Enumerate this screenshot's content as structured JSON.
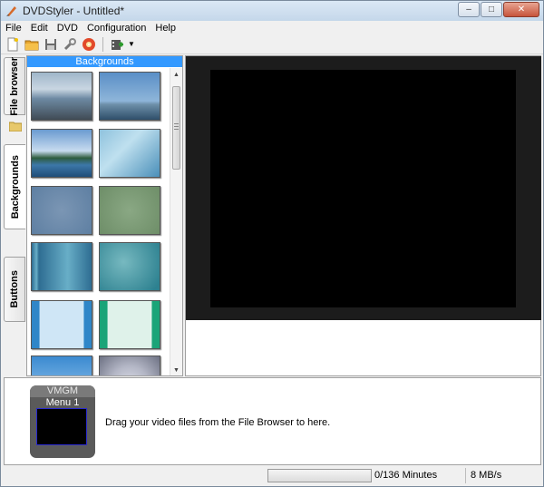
{
  "window": {
    "title": "DVDStyler - Untitled*",
    "buttons": {
      "minimize": "–",
      "maximize": "□",
      "close": "✕"
    }
  },
  "menu": [
    "File",
    "Edit",
    "DVD",
    "Configuration",
    "Help"
  ],
  "toolbar": {
    "icons": [
      "new-project-icon",
      "open-folder-icon",
      "save-icon",
      "settings-icon",
      "burn-dvd-icon",
      "add-file-icon"
    ],
    "dropdown_arrow": "▼"
  },
  "tabs": {
    "file_browser": "File browser",
    "backgrounds": "Backgrounds",
    "buttons": "Buttons",
    "active": "Backgrounds"
  },
  "panel": {
    "header": "Backgrounds",
    "scroll_up": "▲",
    "scroll_down": "▼"
  },
  "thumbnails": [
    {
      "kind": "photo-coast-cloudy",
      "colors": [
        "#9fb6c9",
        "#6e8aa3",
        "#404b55"
      ]
    },
    {
      "kind": "photo-harbor-sky",
      "colors": [
        "#5a8fc7",
        "#8eb5d9",
        "#2f4f6a"
      ]
    },
    {
      "kind": "photo-lake-hills",
      "colors": [
        "#6a9bd0",
        "#c7dbef",
        "#2e5c3e"
      ]
    },
    {
      "kind": "blue-rays",
      "colors": [
        "#8fc2dd",
        "#4a8fb9"
      ]
    },
    {
      "kind": "blurred-blue",
      "colors": [
        "#5e7fa2",
        "#7b96b4"
      ]
    },
    {
      "kind": "blurred-green",
      "colors": [
        "#6e8e68",
        "#8aa884"
      ]
    },
    {
      "kind": "teal-stripes",
      "colors": [
        "#2e6d92",
        "#68aec7"
      ]
    },
    {
      "kind": "teal-texture",
      "colors": [
        "#2d8190",
        "#77b9c0"
      ]
    },
    {
      "kind": "light-blue-frame",
      "colors": [
        "#cfe6f6",
        "#2f86c8"
      ]
    },
    {
      "kind": "mint-frame",
      "colors": [
        "#dff2ea",
        "#1aa478"
      ]
    },
    {
      "kind": "sky-frame",
      "colors": [
        "#3b8ad0",
        "#9ccaf0"
      ]
    },
    {
      "kind": "grey-frame",
      "colors": [
        "#6d7183",
        "#d9dbe6"
      ]
    }
  ],
  "titleset": {
    "vmgm_label": "VMGM",
    "menu_label": "Menu 1",
    "drag_hint": "Drag your video files from the File Browser to here."
  },
  "status": {
    "progress_fraction": 0.0,
    "minutes": "0/136 Minutes",
    "rate": "8 MB/s"
  }
}
